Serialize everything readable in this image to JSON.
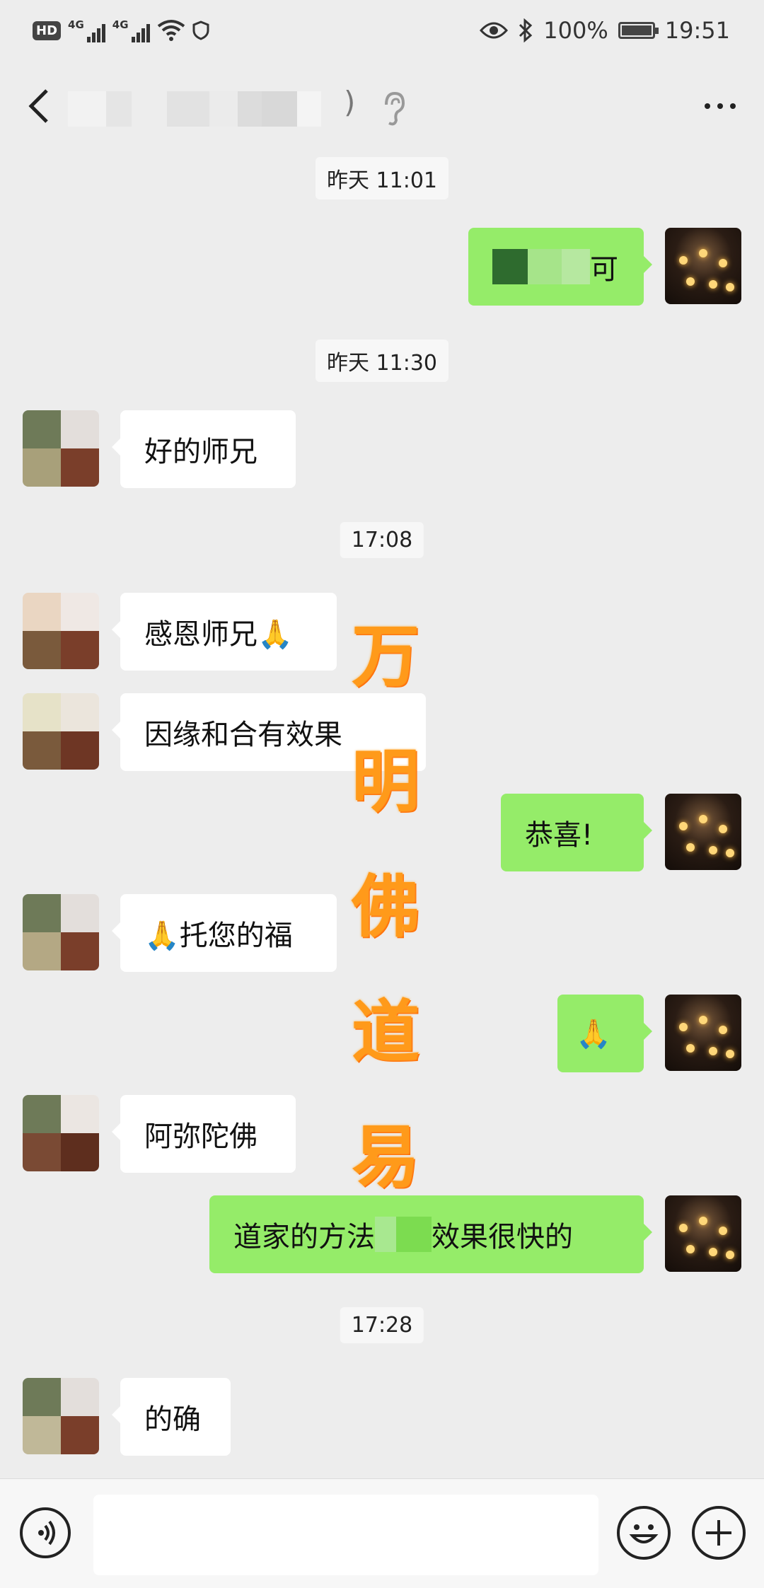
{
  "status_bar": {
    "net1": "4G",
    "net2": "4G",
    "battery": "100%",
    "time": "19:51"
  },
  "header": {
    "paren": ")"
  },
  "messages": {
    "ts1": "昨天 11:01",
    "m1_text": "可",
    "ts2": "昨天 11:30",
    "m2_text": "好的师兄",
    "ts3": "17:08",
    "m3_text": "感恩师兄🙏",
    "m4_text": "因缘和合有效果",
    "m5_text": "恭喜!",
    "m6_text": "🙏托您的福",
    "m7_text": "🙏",
    "m8_text": "阿弥陀佛",
    "m9_part1": "道家的方法",
    "m9_part2": "效果很快的",
    "ts4": "17:28",
    "m10_text": "的确"
  },
  "watermark": [
    "万",
    "明",
    "佛",
    "道",
    "易"
  ],
  "icons": {
    "back": "chevron-left-icon",
    "ear": "ear-icon",
    "more": "more-dots-icon",
    "voice": "voice-icon",
    "emoji": "emoji-icon",
    "plus": "plus-icon"
  },
  "colors": {
    "background": "#ededed",
    "outgoing_bubble": "#95ec69",
    "incoming_bubble": "#ffffff",
    "watermark": "#ff9a1a"
  }
}
